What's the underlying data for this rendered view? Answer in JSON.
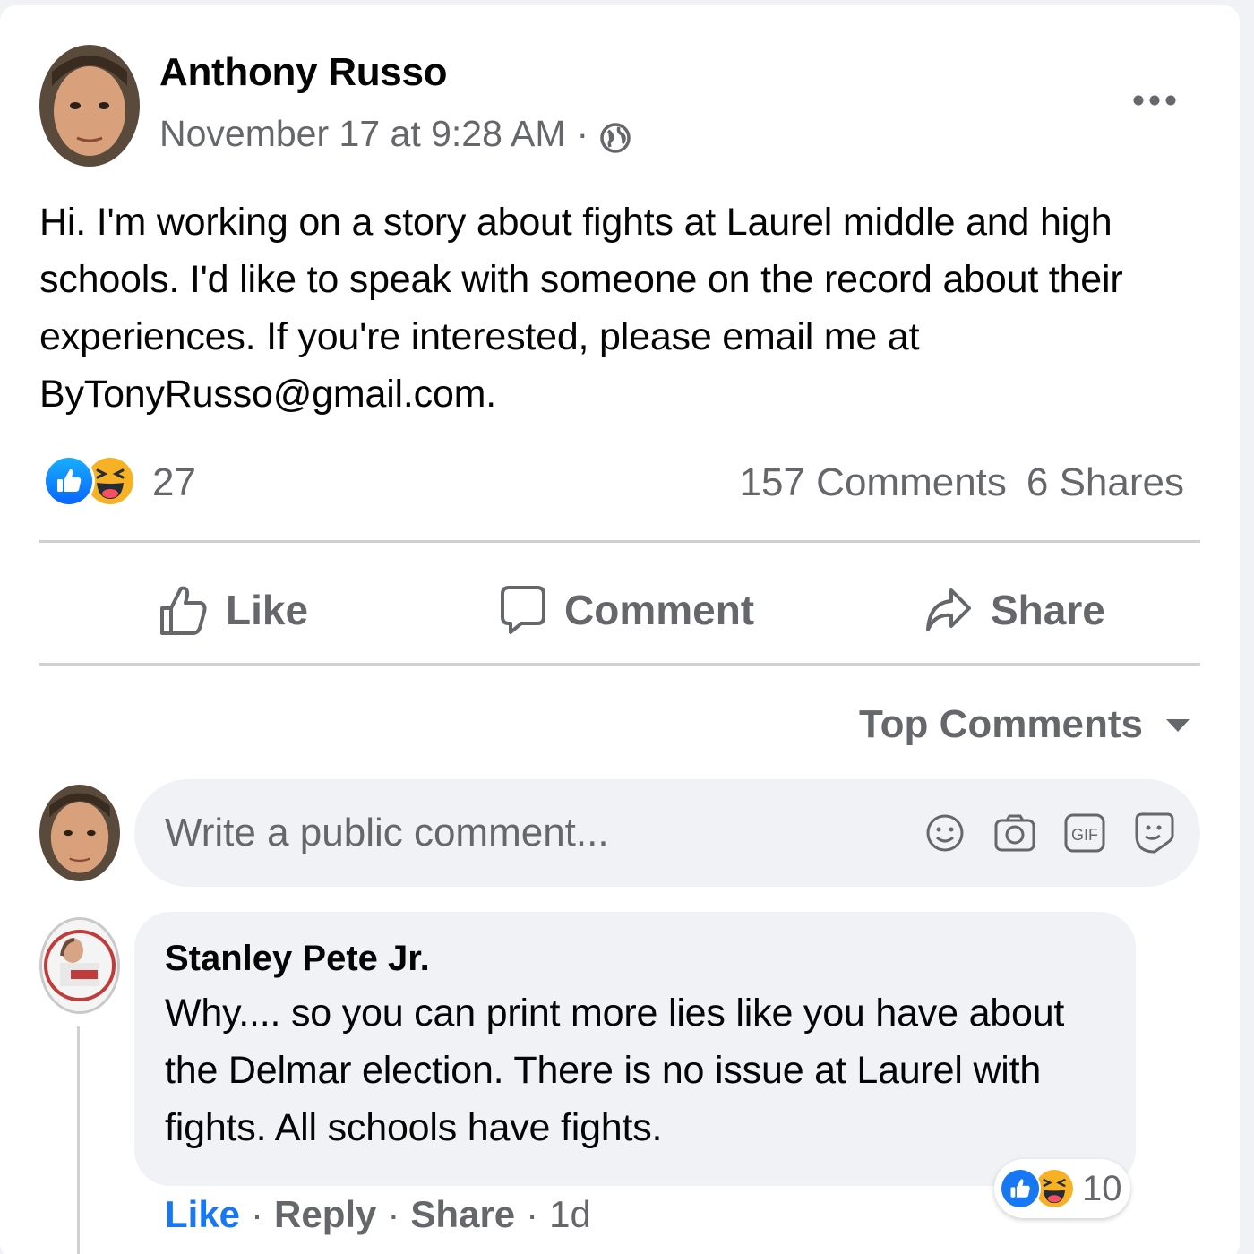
{
  "post": {
    "author": "Anthony Russo",
    "timestamp": "November 17 at 9:28 AM",
    "separator": "·",
    "privacy_icon": "globe-icon",
    "more_icon": "more-options-icon",
    "text": "Hi. I'm working on a story about fights at Laurel middle and high schools. I'd like to speak with someone on the record about their experiences. If you're interested, please email me at ByTonyRusso@gmail.com."
  },
  "reactions": {
    "types": [
      "like",
      "haha"
    ],
    "count": "27",
    "comments": "157 Comments",
    "shares": "6 Shares"
  },
  "actions": {
    "like": "Like",
    "comment": "Comment",
    "share": "Share"
  },
  "sort": {
    "label": "Top Comments"
  },
  "composer": {
    "placeholder": "Write a public comment...",
    "icons": [
      "emoji-icon",
      "camera-icon",
      "gif-icon",
      "sticker-icon"
    ]
  },
  "comment": {
    "author": "Stanley Pete Jr.",
    "text": "Why.... so you can print more lies like you have about the Delmar election. There is no issue at Laurel with fights. All schools have fights.",
    "reaction_count": "10",
    "like": "Like",
    "reply": "Reply",
    "share": "Share",
    "age": "1d",
    "separator": "·"
  },
  "colors": {
    "accent": "#1877f2",
    "secondary_text": "#65676b",
    "bubble": "#f0f2f5",
    "haha": "#f7b125"
  }
}
